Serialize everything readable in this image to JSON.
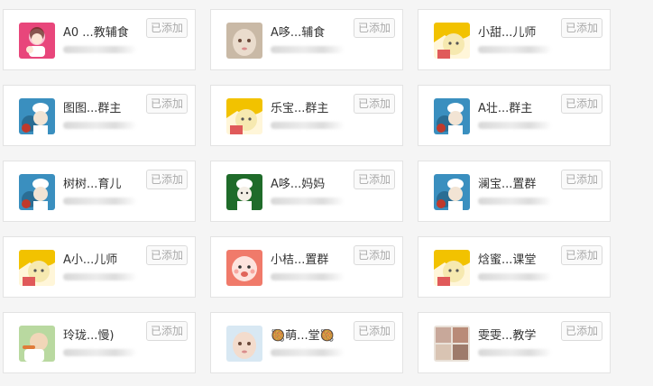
{
  "contacts": [
    {
      "name": "A0 ...教辅食",
      "sub": "",
      "action": "已添加",
      "avatar": "avatar-cartoon-family",
      "avatar_colors": [
        "#e8467b",
        "#f7c3d4"
      ]
    },
    {
      "name": "A哆...辅食",
      "sub": "",
      "action": "已添加",
      "avatar": "avatar-baby-photo",
      "avatar_colors": [
        "#c9b9a6",
        "#eadccd"
      ]
    },
    {
      "name": "小甜...儿师",
      "sub": "",
      "action": "已添加",
      "avatar": "avatar-yellow-baby",
      "avatar_colors": [
        "#f2c200",
        "#f6e9b0"
      ]
    },
    {
      "name": "图图...群主",
      "sub": "",
      "action": "已添加",
      "avatar": "avatar-chef-blue",
      "avatar_colors": [
        "#3a8fbf",
        "#f2e4d4"
      ]
    },
    {
      "name": "乐宝...群主",
      "sub": "",
      "action": "已添加",
      "avatar": "avatar-yellow-baby",
      "avatar_colors": [
        "#f2c200",
        "#f6e9b0"
      ]
    },
    {
      "name": "A壮...群主",
      "sub": "",
      "action": "已添加",
      "avatar": "avatar-chef-blue",
      "avatar_colors": [
        "#3a8fbf",
        "#f2e4d4"
      ]
    },
    {
      "name": "树树...育儿",
      "sub": "",
      "action": "已添加",
      "avatar": "avatar-chef-blue",
      "avatar_colors": [
        "#3a8fbf",
        "#f2e4d4"
      ]
    },
    {
      "name": "A哆...妈妈",
      "sub": "",
      "action": "已添加",
      "avatar": "avatar-chef-green",
      "avatar_colors": [
        "#1f6b2a",
        "#f4efe6"
      ]
    },
    {
      "name": "澜宝...置群",
      "sub": "",
      "action": "已添加",
      "avatar": "avatar-chef-blue",
      "avatar_colors": [
        "#3a8fbf",
        "#f2e4d4"
      ]
    },
    {
      "name": "A小...儿师",
      "sub": "",
      "action": "已添加",
      "avatar": "avatar-yellow-baby",
      "avatar_colors": [
        "#f2c200",
        "#f6e9b0"
      ]
    },
    {
      "name": "小桔...置群",
      "sub": "",
      "action": "已添加",
      "avatar": "avatar-cartoon-baby",
      "avatar_colors": [
        "#f07a6a",
        "#fde3dd"
      ]
    },
    {
      "name": "焓蜜...课堂",
      "sub": "",
      "action": "已添加",
      "avatar": "avatar-yellow-baby",
      "avatar_colors": [
        "#f2c200",
        "#f6e9b0"
      ]
    },
    {
      "name": "玲珑...慢)",
      "sub": "",
      "action": "已添加",
      "avatar": "avatar-baby-eating",
      "avatar_colors": [
        "#b9d9a0",
        "#f1d6b8"
      ]
    },
    {
      "name": "🥘萌...堂🥘",
      "sub": "",
      "action": "已添加",
      "avatar": "avatar-baby-photo",
      "avatar_colors": [
        "#d8e8f3",
        "#f3dccd"
      ]
    },
    {
      "name": "雯雯...教学",
      "sub": "",
      "action": "已添加",
      "avatar": "avatar-collage",
      "avatar_colors": [
        "#c8a89a",
        "#e9e1d8"
      ]
    }
  ]
}
